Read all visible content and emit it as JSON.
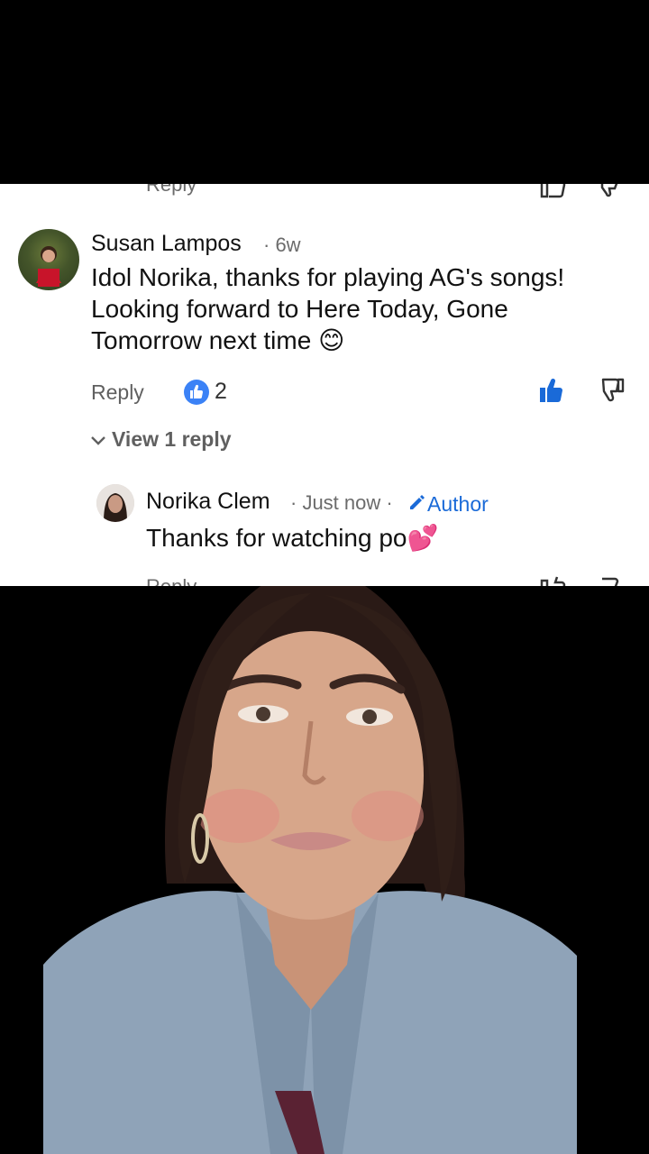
{
  "previous_comment": {
    "reply_label": "Reply"
  },
  "comment": {
    "author": "Susan Lampos",
    "age": "· 6w",
    "text_lines": [
      "Idol Norika, thanks for playing AG's songs!",
      "Looking forward to Here Today, Gone",
      "Tomorrow next time 😊"
    ],
    "reply_label": "Reply",
    "like_count": "2",
    "view_replies_label": "View 1 reply"
  },
  "reply": {
    "author": "Norika Clem",
    "age": "· Just now ·",
    "author_badge": "Author",
    "text": "Thanks for watching po💕",
    "reply_label": "Reply"
  },
  "colors": {
    "accent_blue": "#1a6ad8",
    "badge_blue": "#3b82f6"
  },
  "icons": [
    "thumbs-up-icon",
    "thumbs-down-icon",
    "chevron-down-icon",
    "pencil-icon"
  ]
}
